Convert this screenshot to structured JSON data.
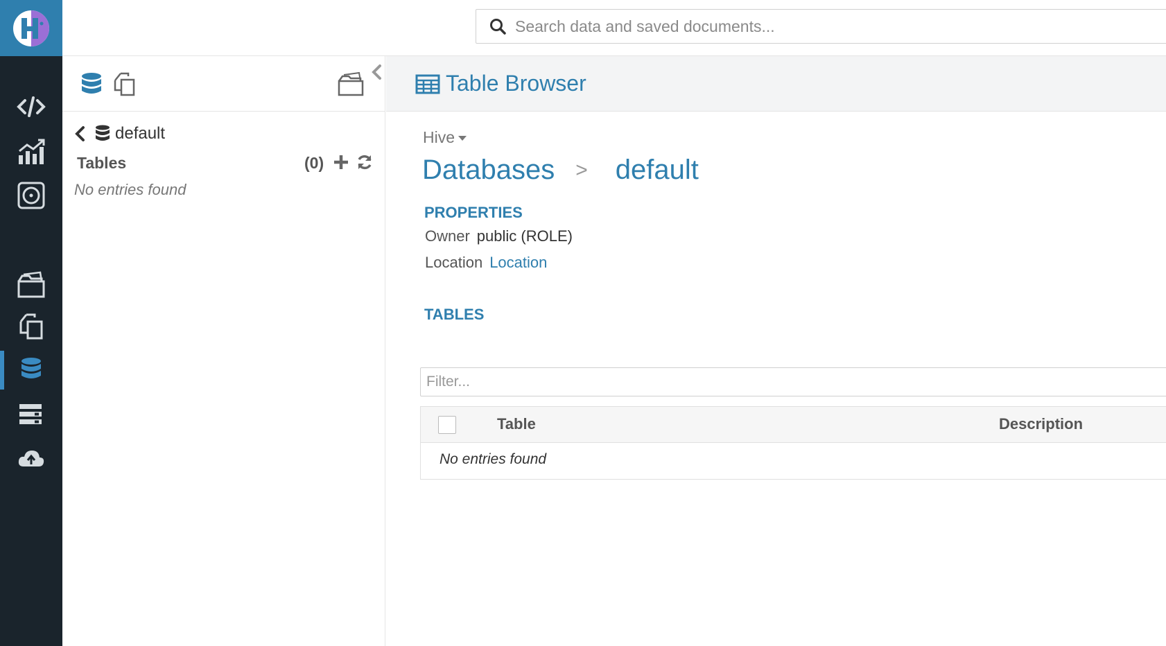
{
  "topbar": {
    "search_placeholder": "Search data and saved documents..."
  },
  "nav": {
    "logo": "hue-logo-icon",
    "items": [
      {
        "icon": "code-editor-icon"
      },
      {
        "icon": "dashboard-chart-icon"
      },
      {
        "icon": "scheduler-icon"
      },
      {
        "icon": "file-browser-icon"
      },
      {
        "icon": "documents-icon"
      },
      {
        "icon": "database-icon",
        "active": true
      },
      {
        "icon": "jobs-icon"
      },
      {
        "icon": "cloud-upload-icon"
      }
    ]
  },
  "assist": {
    "database_name": "default",
    "tables_label": "Tables",
    "tables_count": "(0)",
    "empty_text": "No entries found"
  },
  "main": {
    "title": "Table Browser",
    "engine": "Hive",
    "breadcrumb": {
      "root": "Databases",
      "separator": ">",
      "current": "default"
    },
    "properties": {
      "heading": "PROPERTIES",
      "owner_label": "Owner",
      "owner_value": "public (ROLE)",
      "location_label": "Location",
      "location_value": "Location"
    },
    "tables": {
      "heading": "TABLES",
      "filter_placeholder": "Filter...",
      "col_table": "Table",
      "col_description": "Description",
      "empty_text": "No entries found"
    }
  },
  "colors": {
    "accent": "#2f7fae",
    "nav_bg": "#1a242c",
    "logo_bg": "#2f7fae",
    "logo_accent": "#9b6fd6"
  }
}
